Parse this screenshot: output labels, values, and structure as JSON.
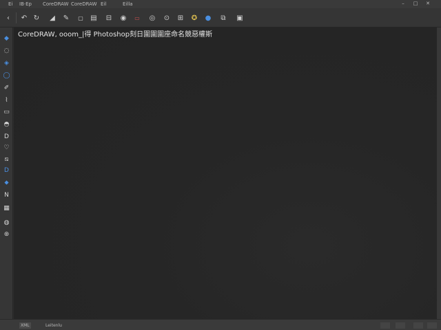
{
  "menu": {
    "items": [
      "Ei",
      "IB·Ep",
      "CoreDRAW",
      "CoreDRAW",
      "Eil",
      "Eilla"
    ]
  },
  "toolbar": {
    "buttons": [
      {
        "icon": "back-icon",
        "glyph": "‹"
      },
      {
        "icon": "undo-icon",
        "glyph": "↶"
      },
      {
        "icon": "redo-icon",
        "glyph": "↻"
      },
      {
        "icon": "shape-icon",
        "glyph": "◢"
      },
      {
        "icon": "edit-icon",
        "glyph": "✎"
      },
      {
        "icon": "chat-icon",
        "glyph": "💬"
      },
      {
        "icon": "layout-icon",
        "glyph": "▤"
      },
      {
        "icon": "link-icon",
        "glyph": "⛓"
      },
      {
        "icon": "eye-icon",
        "glyph": "👁"
      },
      {
        "icon": "record-icon",
        "glyph": "●"
      },
      {
        "icon": "spiral-icon",
        "glyph": "◎"
      },
      {
        "icon": "target-icon",
        "glyph": "⊙"
      },
      {
        "icon": "grid-icon",
        "glyph": "⊞"
      },
      {
        "icon": "badge-icon",
        "glyph": "✪"
      },
      {
        "icon": "globe-icon",
        "glyph": "●"
      },
      {
        "icon": "layers-icon",
        "glyph": "⧉"
      },
      {
        "icon": "panel-icon",
        "glyph": "▣"
      }
    ]
  },
  "tools": [
    {
      "icon": "pick-tool-icon",
      "glyph": "◆"
    },
    {
      "icon": "shape-tool-icon",
      "glyph": "◌"
    },
    {
      "icon": "crop-tool-icon",
      "glyph": "◈"
    },
    {
      "icon": "zoom-tool-icon",
      "glyph": "◯"
    },
    {
      "icon": "freehand-tool-icon",
      "glyph": "✐"
    },
    {
      "icon": "artistic-media-icon",
      "glyph": "⌇"
    },
    {
      "icon": "rectangle-tool-icon",
      "glyph": "▭"
    },
    {
      "icon": "ellipse-tool-icon",
      "glyph": "◓"
    },
    {
      "icon": "polygon-tool-icon",
      "glyph": "D"
    },
    {
      "icon": "text-tool-icon",
      "glyph": "♡"
    },
    {
      "icon": "table-tool-icon",
      "glyph": "⧅"
    },
    {
      "icon": "dimension-tool-icon",
      "glyph": "D"
    },
    {
      "icon": "connector-tool-icon",
      "glyph": "⬥"
    },
    {
      "icon": "blend-tool-icon",
      "glyph": "N"
    },
    {
      "icon": "transparency-tool-icon",
      "glyph": "▦"
    },
    {
      "icon": "eyedropper-tool-icon",
      "glyph": "◍"
    },
    {
      "icon": "fill-tool-icon",
      "glyph": "⊛"
    }
  ],
  "canvas": {
    "text": "CoreDRAW, ooom_|得 Photoshop刻日圍圍圍座命名競惡權斯"
  },
  "status": {
    "left": "XML",
    "middle": "Leitenlu",
    "right1": "",
    "right2": ""
  },
  "colors": {
    "accent": "#4a8fe0",
    "background": "#2e2e2e"
  }
}
